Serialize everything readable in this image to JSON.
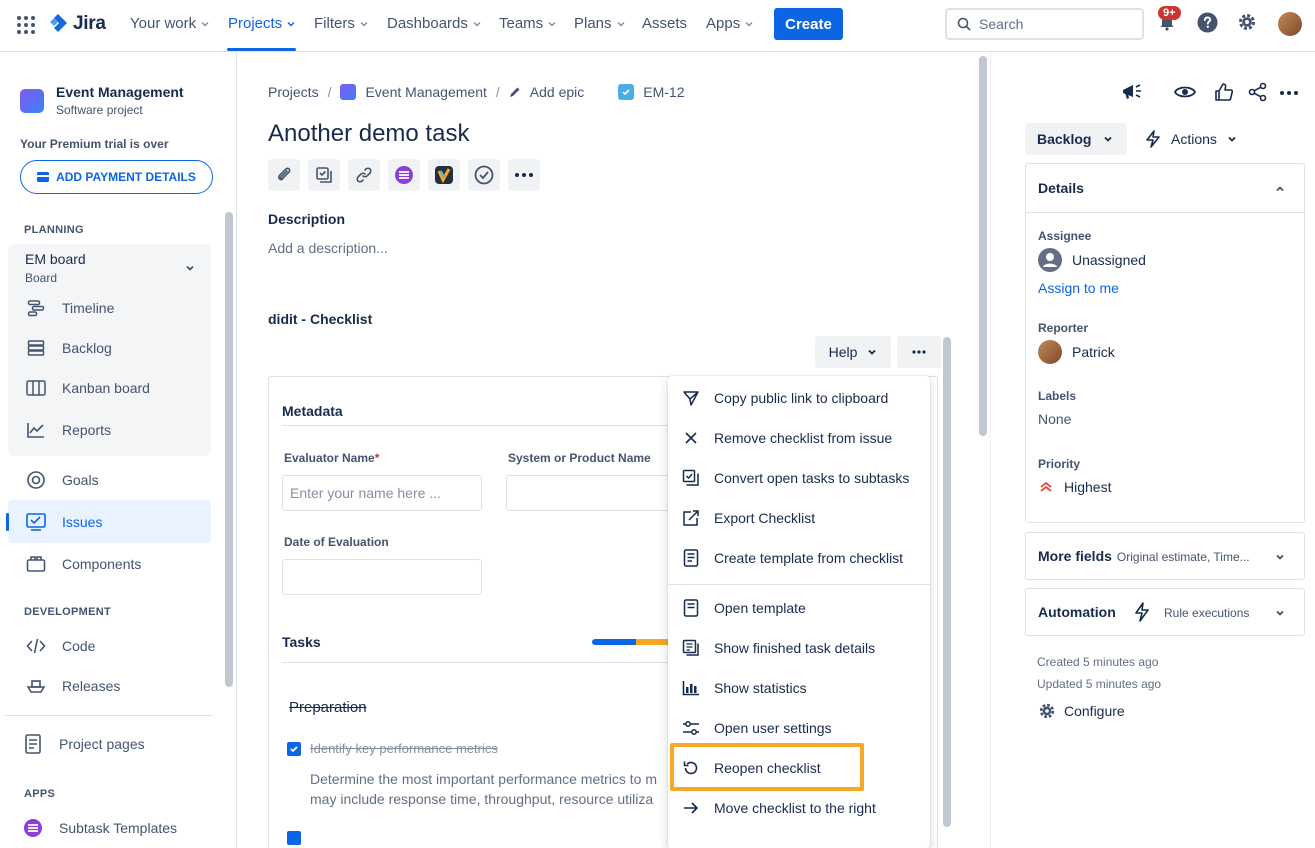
{
  "topnav": {
    "logo": "Jira",
    "items": [
      "Your work",
      "Projects",
      "Filters",
      "Dashboards",
      "Teams",
      "Plans",
      "Assets",
      "Apps"
    ],
    "create": "Create",
    "search_placeholder": "Search",
    "notification_badge": "9+"
  },
  "sidebar": {
    "project_name": "Event Management",
    "project_type": "Software project",
    "trial_text": "Your Premium trial is over",
    "payment_button": "ADD PAYMENT DETAILS",
    "planning_label": "PLANNING",
    "board_title": "EM board",
    "board_sub": "Board",
    "planning_items": [
      "Timeline",
      "Backlog",
      "Kanban board",
      "Reports"
    ],
    "items": [
      "Goals",
      "Issues",
      "Components"
    ],
    "development_label": "DEVELOPMENT",
    "development_items": [
      "Code",
      "Releases"
    ],
    "project_pages": "Project pages",
    "apps_label": "APPS",
    "apps_items": [
      "Subtask Templates"
    ]
  },
  "breadcrumb": [
    "Projects",
    "Event Management",
    "Add epic",
    "EM-12"
  ],
  "issue": {
    "title": "Another demo task",
    "description_label": "Description",
    "description_placeholder": "Add a description..."
  },
  "checklist": {
    "title": "didit - Checklist",
    "help": "Help",
    "metadata": "Metadata",
    "evaluator_label": "Evaluator Name",
    "evaluator_placeholder": "Enter your name here ...",
    "system_label": "System or Product Name",
    "date_label": "Date of Evaluation",
    "tasks": "Tasks",
    "section": "Preparation",
    "task1": "Identify key performance metrics",
    "task1_desc_line1": "Determine the most important performance metrics to m",
    "task1_desc_line2": "may include response time, throughput, resource utiliza"
  },
  "menu": {
    "items": [
      "Copy public link to clipboard",
      "Remove checklist from issue",
      "Convert open tasks to subtasks",
      "Export Checklist",
      "Create template from checklist",
      "Open template",
      "Show finished task details",
      "Show statistics",
      "Open user settings",
      "Reopen checklist",
      "Move checklist to the right"
    ]
  },
  "right_panel": {
    "status": "Backlog",
    "actions": "Actions",
    "details": "Details",
    "assignee_label": "Assignee",
    "assignee_value": "Unassigned",
    "assign_to_me": "Assign to me",
    "reporter_label": "Reporter",
    "reporter_value": "Patrick",
    "labels_label": "Labels",
    "labels_value": "None",
    "priority_label": "Priority",
    "priority_value": "Highest",
    "more_fields": "More fields",
    "more_fields_sub": "Original estimate, Time...",
    "automation": "Automation",
    "automation_sub": "Rule executions",
    "created": "Created 5 minutes ago",
    "updated": "Updated 5 minutes ago",
    "configure": "Configure"
  },
  "colors": {
    "brand_blue": "#0c66e4",
    "highlight": "#f9a825",
    "priority_highest": "#e2483d"
  }
}
